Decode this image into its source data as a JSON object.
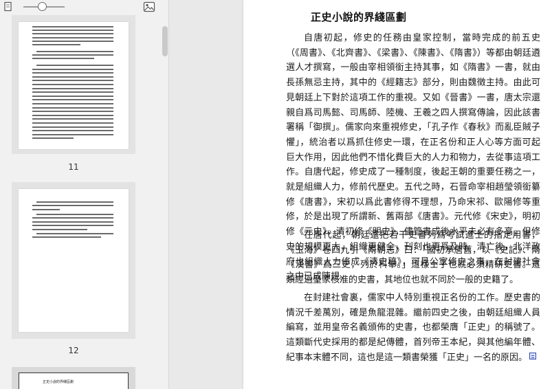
{
  "sidebar": {
    "thumbnails": [
      {
        "page_label": "11"
      },
      {
        "page_label": "12"
      },
      {
        "title": "正史小說的界綫區劃"
      }
    ]
  },
  "icons": {
    "small_thumbnails": "page-small-icon",
    "large_thumbnails": "image-large-icon",
    "footnote": "footnote-marker-icon"
  },
  "document": {
    "title": "正史小說的界綫區劃",
    "paragraphs": [
      "自唐初起，修史的任務由皇家控制，當時完成的前五史（《周書》、《北齊書》、《梁書》、《陳書》、《隋書》）等都由朝廷遴選人才撰寫，一般由宰相領銜主持其事，如《隋書》一書，就由長孫無忌主持，其中的《經籍志》部分，則由魏徵主持。由此可見朝廷上下對於這項工作的重視。又如《晉書》一書，唐太宗還親自爲司馬懿、司馬師、陸機、王羲之四人撰寫傳論，因此該書署稱「御撰」。儒家向來重視修史，「孔子作《春秋》而亂臣賊子懼」，統治者以爲抓住修史一環，在正名份和正人心等方面可起巨大作用，因此他們不惜化費巨大的人力和物力，去從事這項工作。自唐代起，修史成了一種制度，後起王朝的重要任務之一，就是組織人力，修前代歷史。五代之時，石晉命宰相趙瑩領銜纂修《唐書》，宋初以爲此書修得不理想，乃命宋祁、歐陽修等重修，於是出現了所謂新、舊兩部《唐書》。元代修《宋史》，明初修《元史》，清初修《明史》，儘管書成後水平未必有多高，但修史的規模更大，組織更健全，刊刻也更爲及時。清亡後，北洋政府也組織人力修成《清史稿》，可見公家修史之事，在封建社會之中已成陳規。",
      "在唐代起，朝廷還把若干史書列爲考試進士的指定用書，《玉海》卷四九引《兩朝志》曰：「國初承唐舊，以《史記》、兩《漢書》爲三史，列於科舉。」這樣士子也就必須精研史書。這類經過皇家核准的史書，其地位也就不同於一般的史籍了。",
      "在封建社會裏，儒家中人特別重視正名份的工作。歷史書的情況千差萬別，確是魚龍混雜。繼前四史之後，由朝廷組織人員編寫，並用皇帝名義頒佈的史書，也都榮膺「正史」的稱號了。這類斷代史採用的都是紀傳體，首列帝王本紀，與其他編年體、紀事本末體不同，這也是這一類書榮獲「正史」一名的原因。"
    ]
  },
  "colors": {
    "panel_background": "#f1f1f1",
    "thumbnail_frame": "#e3e3e3",
    "page_background": "#ffffff",
    "text": "#1a1a1a",
    "footnote_marker": "#2b46a8"
  }
}
